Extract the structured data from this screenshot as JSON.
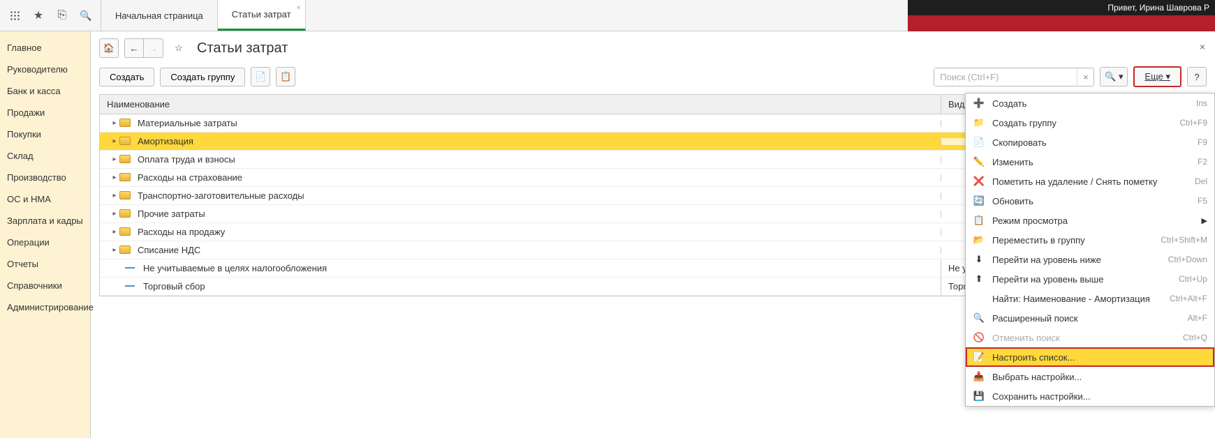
{
  "header": {
    "tab1": "Начальная страница",
    "tab2": "Статьи затрат",
    "greeting": "Привет, Ирина Шаврова Р"
  },
  "sidebar": {
    "items": [
      "Главное",
      "Руководителю",
      "Банк и касса",
      "Продажи",
      "Покупки",
      "Склад",
      "Производство",
      "ОС и НМА",
      "Зарплата и кадры",
      "Операции",
      "Отчеты",
      "Справочники",
      "Администрирование"
    ]
  },
  "page": {
    "title": "Статьи затрат",
    "create_btn": "Создать",
    "create_group_btn": "Создать группу",
    "search_placeholder": "Поиск (Ctrl+F)",
    "more_btn": "Еще",
    "help_btn": "?"
  },
  "table": {
    "col_name": "Наименование",
    "col_type": "Вид расходов НУ",
    "rows": [
      {
        "name": "Материальные затраты",
        "type": "",
        "folder": true
      },
      {
        "name": "Амортизация",
        "type": "",
        "folder": true,
        "selected": true
      },
      {
        "name": "Оплата труда и взносы",
        "type": "",
        "folder": true
      },
      {
        "name": "Расходы на страхование",
        "type": "",
        "folder": true
      },
      {
        "name": "Транспортно-заготовительные расходы",
        "type": "",
        "folder": true
      },
      {
        "name": "Прочие затраты",
        "type": "",
        "folder": true
      },
      {
        "name": "Расходы на продажу",
        "type": "",
        "folder": true
      },
      {
        "name": "Списание НДС",
        "type": "",
        "folder": true
      },
      {
        "name": "Не учитываемые в целях налогообложения",
        "type": "Не учитываемые в целях налогообложения",
        "folder": false
      },
      {
        "name": "Торговый сбор",
        "type": "Торговый сбор",
        "folder": false
      }
    ]
  },
  "menu": {
    "items": [
      {
        "icon": "➕",
        "label": "Создать",
        "shortcut": "Ins"
      },
      {
        "icon": "📁",
        "label": "Создать группу",
        "shortcut": "Ctrl+F9"
      },
      {
        "icon": "📄",
        "label": "Скопировать",
        "shortcut": "F9"
      },
      {
        "icon": "✏️",
        "label": "Изменить",
        "shortcut": "F2"
      },
      {
        "icon": "❌",
        "label": "Пометить на удаление / Снять пометку",
        "shortcut": "Del"
      },
      {
        "icon": "🔄",
        "label": "Обновить",
        "shortcut": "F5"
      },
      {
        "icon": "📋",
        "label": "Режим просмотра",
        "shortcut": "",
        "submenu": true
      },
      {
        "icon": "📂",
        "label": "Переместить в группу",
        "shortcut": "Ctrl+Shift+M"
      },
      {
        "icon": "⬇",
        "label": "Перейти на уровень ниже",
        "shortcut": "Ctrl+Down"
      },
      {
        "icon": "⬆",
        "label": "Перейти на уровень выше",
        "shortcut": "Ctrl+Up"
      },
      {
        "icon": "",
        "label": "Найти: Наименование - Амортизация",
        "shortcut": "Ctrl+Alt+F"
      },
      {
        "icon": "🔍",
        "label": "Расширенный поиск",
        "shortcut": "Alt+F"
      },
      {
        "icon": "🚫",
        "label": "Отменить поиск",
        "shortcut": "Ctrl+Q",
        "disabled": true
      },
      {
        "icon": "📝",
        "label": "Настроить список...",
        "shortcut": "",
        "highlighted": true
      },
      {
        "icon": "📥",
        "label": "Выбрать настройки...",
        "shortcut": ""
      },
      {
        "icon": "💾",
        "label": "Сохранить настройки...",
        "shortcut": ""
      }
    ]
  }
}
